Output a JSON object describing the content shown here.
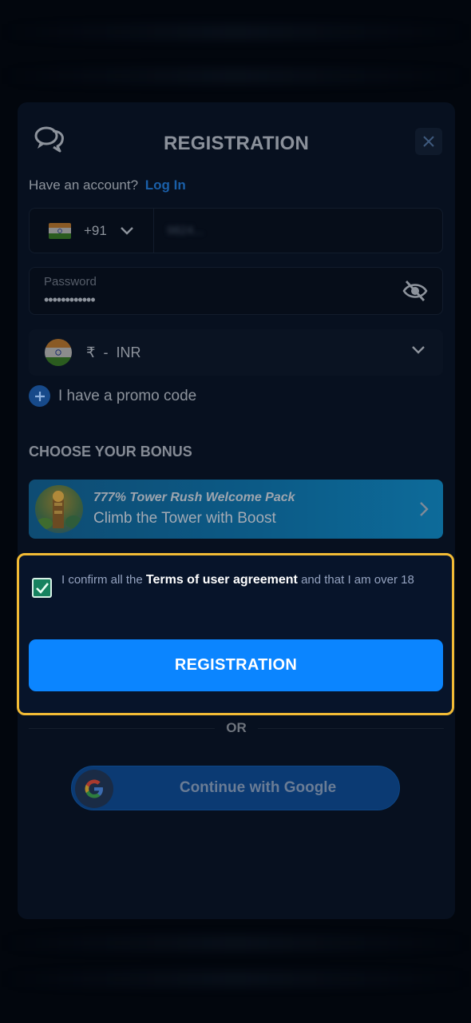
{
  "modal": {
    "title": "REGISTRATION",
    "have_account_text": "Have an account?",
    "login_link": "Log In"
  },
  "phone": {
    "country_code": "+91",
    "number": "9824..."
  },
  "password": {
    "label": "Password",
    "value": "••••••••••••"
  },
  "currency": {
    "symbol": "₹",
    "separator": "-",
    "code": "INR"
  },
  "promo": {
    "label": "I have a promo code"
  },
  "bonus": {
    "heading": "CHOOSE YOUR BONUS",
    "card_title": "777% Tower Rush Welcome Pack",
    "card_subtitle": "Climb the Tower with Boost"
  },
  "agreement": {
    "checked": true,
    "prefix": "I confirm all the",
    "terms_link": "Terms of user agreement",
    "suffix": "and that I am over 18"
  },
  "actions": {
    "register_label": "REGISTRATION",
    "or_label": "OR",
    "google_label": "Continue with Google"
  },
  "colors": {
    "primary_button": "#0b85ff",
    "highlight_border": "#f2bb35",
    "checkbox": "#16825f",
    "modal_bg": "#07101f"
  },
  "icons": [
    "chat-icon",
    "close-icon",
    "chevron-down-icon",
    "eye-off-icon",
    "plus-icon",
    "chevron-right-icon",
    "check-icon",
    "google-icon"
  ]
}
